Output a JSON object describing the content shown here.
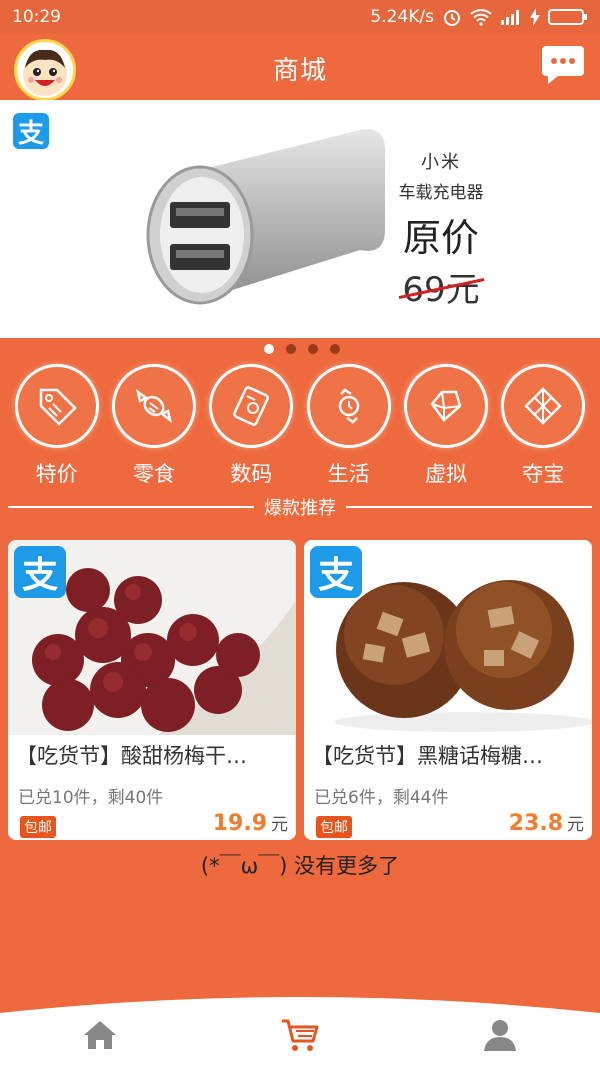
{
  "status_bar": {
    "time": "10:29",
    "network_speed": "5.24K/s"
  },
  "header": {
    "title": "商城"
  },
  "banner": {
    "brand": "小米",
    "product": "车载充电器",
    "original_label": "原价",
    "original_price": "69元",
    "dots_total": 4,
    "active_dot": 0
  },
  "categories": [
    {
      "label": "特价",
      "icon": "tag-icon"
    },
    {
      "label": "零食",
      "icon": "candy-icon"
    },
    {
      "label": "数码",
      "icon": "device-icon"
    },
    {
      "label": "生活",
      "icon": "watch-icon"
    },
    {
      "label": "虚拟",
      "icon": "diamond-icon"
    },
    {
      "label": "夺宝",
      "icon": "gift-icon"
    }
  ],
  "section": {
    "title": "爆款推荐"
  },
  "products": [
    {
      "title": "【吃货节】酸甜杨梅干…",
      "stock": "已兑10件，剩40件",
      "badge": "包邮",
      "price": "19.9",
      "unit": "元"
    },
    {
      "title": "【吃货节】黑糖话梅糖…",
      "stock": "已兑6件，剩44件",
      "badge": "包邮",
      "price": "23.8",
      "unit": "元"
    }
  ],
  "alipay_glyph": "支",
  "no_more_text": "(*￣ω￣) 没有更多了",
  "colors": {
    "primary": "#ee6a3e",
    "price": "#f07c2e",
    "alipay": "#1e9be8",
    "nav_active": "#e8541d",
    "nav_inactive": "#888888"
  },
  "nav": {
    "items": [
      "home-icon",
      "cart-icon",
      "user-icon"
    ],
    "active": 1
  }
}
